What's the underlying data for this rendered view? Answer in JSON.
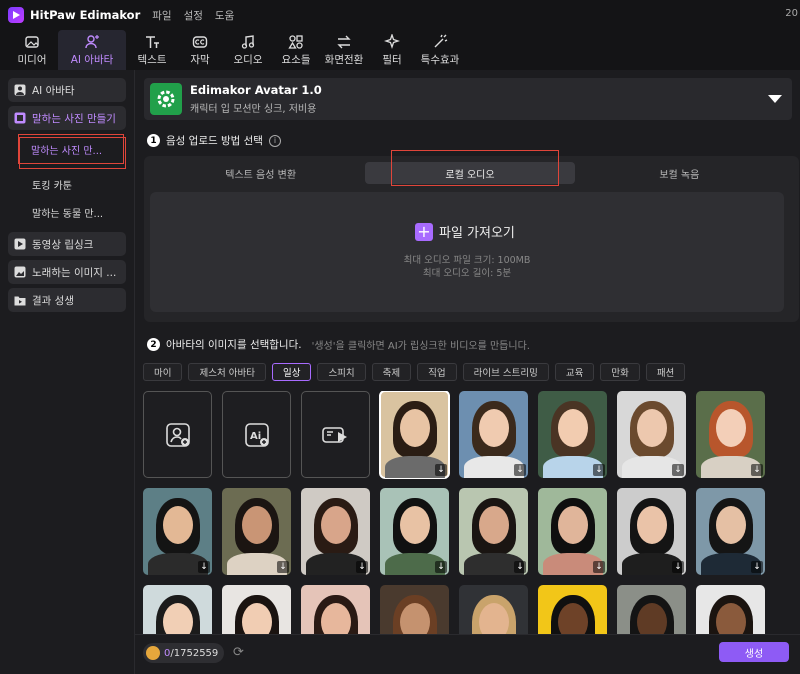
{
  "titlebar": {
    "app": "HitPaw Edimakor",
    "menu": [
      "파일",
      "설정",
      "도움"
    ],
    "corner": "20"
  },
  "toolbar": {
    "items": [
      {
        "label": "미디어",
        "icon": "image-icon"
      },
      {
        "label": "AI 아바타",
        "icon": "avatar-icon"
      },
      {
        "label": "텍스트",
        "icon": "text-icon"
      },
      {
        "label": "자막",
        "icon": "caption-icon"
      },
      {
        "label": "오디오",
        "icon": "music-icon"
      },
      {
        "label": "요소들",
        "icon": "elements-icon"
      },
      {
        "label": "화면전환",
        "icon": "transition-icon"
      },
      {
        "label": "필터",
        "icon": "filter-icon"
      },
      {
        "label": "특수효과",
        "icon": "effects-icon"
      }
    ]
  },
  "sidebar": {
    "items": [
      {
        "label": "AI 아바타",
        "type": "group"
      },
      {
        "label": "말하는 사진 만들기",
        "type": "group"
      },
      {
        "label": "말하는 사진 만...",
        "type": "sub"
      },
      {
        "label": "토킹 카툰",
        "type": "sub"
      },
      {
        "label": "말하는 동물 만...",
        "type": "sub"
      },
      {
        "label": "동영상 립싱크",
        "type": "group"
      },
      {
        "label": "노래하는 이미지 ...",
        "type": "group"
      },
      {
        "label": "결과 성생",
        "type": "group"
      }
    ]
  },
  "avatar": {
    "title": "Edimakor Avatar 1.0",
    "subtitle": "캐릭터 입 모션만 싱크, 저비용"
  },
  "step1": {
    "num": "1",
    "label": "음성 업로드 방법 선택"
  },
  "audio_tabs": [
    "텍스트 음성 변환",
    "로컬 오디오",
    "보컬 녹음"
  ],
  "dropzone": {
    "button": "파일 가져오기",
    "line1": "최대 오디오 파일 크기: 100MB",
    "line2": "최대 오디오 길이: 5분"
  },
  "step2": {
    "num": "2",
    "label": "아바타의 이미지를 선택합니다.",
    "hint": "'생성'을 클릭하면 AI가 립싱크한 비디오를 만듭니다."
  },
  "categories": [
    "마이",
    "제스처 아바타",
    "일상",
    "스피치",
    "축제",
    "직업",
    "라이브 스트리밍",
    "교육",
    "만화",
    "패션"
  ],
  "active_category": "일상",
  "upload_tiles": [
    "upload-photo-icon",
    "ai-photo-icon",
    "video-avatar-icon"
  ],
  "credits": {
    "value": "0",
    "total": "/1752559"
  },
  "generate_label": "생성",
  "colors": {
    "accent": "#a86bff",
    "highlight": "#e0453a"
  }
}
